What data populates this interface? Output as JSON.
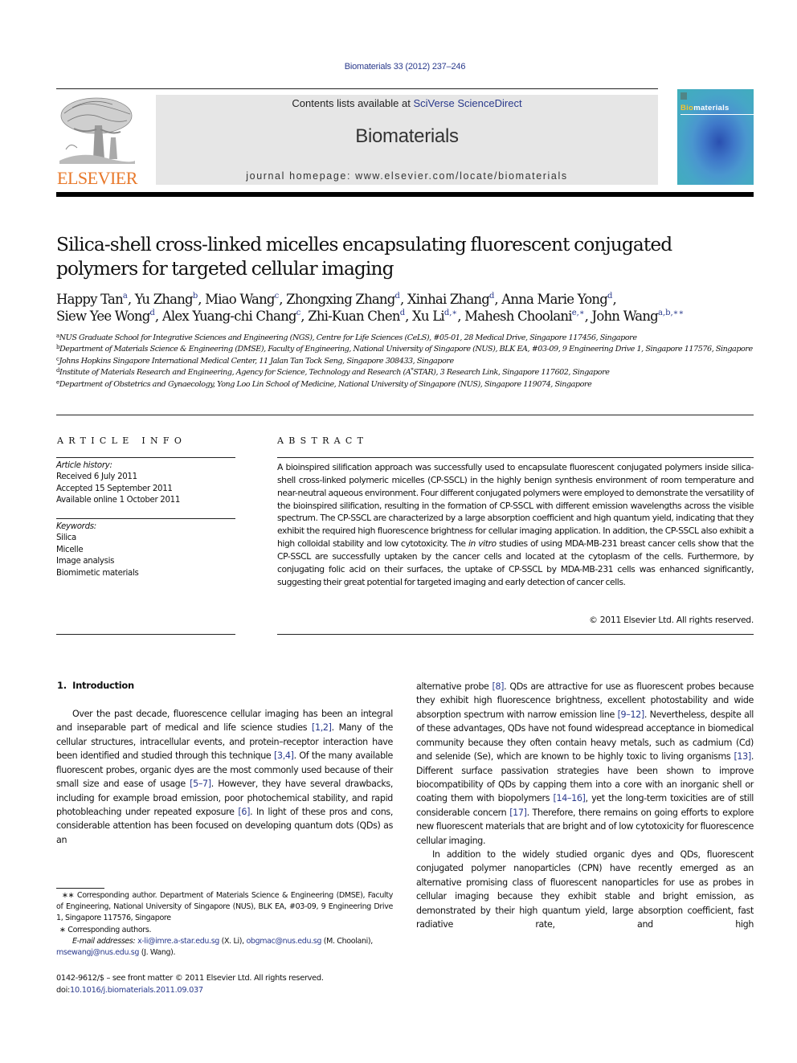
{
  "header": {
    "citation": "Biomaterials 33 (2012) 237–246",
    "publisher_logo_text": "ELSEVIER",
    "contents_prefix": "Contents lists available at ",
    "contents_link": "SciVerse ScienceDirect",
    "journal_title": "Biomaterials",
    "homepage_line": "journal homepage: www.elsevier.com/locate/biomaterials",
    "cover": {
      "title_highlight": "Bio",
      "title_rest": "materials",
      "colors": {
        "highlight": "#f3c42e",
        "background": "#46a6c7"
      }
    }
  },
  "article": {
    "title": "Silica-shell cross-linked micelles encapsulating fluorescent conjugated polymers for targeted cellular imaging",
    "authors": [
      {
        "name": "Happy Tan",
        "sup": "a",
        "sep": ", "
      },
      {
        "name": "Yu Zhang",
        "sup": "b",
        "sep": ", "
      },
      {
        "name": "Miao Wang",
        "sup": "c",
        "sep": ", "
      },
      {
        "name": "Zhongxing Zhang",
        "sup": "d",
        "sep": ", "
      },
      {
        "name": "Xinhai Zhang",
        "sup": "d",
        "sep": ", "
      },
      {
        "name": "Anna Marie Yong",
        "sup": "d",
        "sep": ", "
      },
      {
        "name": "Siew Yee Wong",
        "sup": "d",
        "sep": ", "
      },
      {
        "name": "Alex Yuang-chi Chang",
        "sup": "c",
        "sep": ", "
      },
      {
        "name": "Zhi-Kuan Chen",
        "sup": "d",
        "sep": ", "
      },
      {
        "name": "Xu Li",
        "sup": "d,∗",
        "sep": ", "
      },
      {
        "name": "Mahesh Choolani",
        "sup": "e,∗",
        "sep": ", "
      },
      {
        "name": "John Wang",
        "sup": "a,b,∗∗",
        "sep": ""
      }
    ],
    "affiliations": [
      {
        "key": "a",
        "text": "NUS Graduate School for Integrative Sciences and Engineering (NGS), Centre for Life Sciences (CeLS), #05-01, 28 Medical Drive, Singapore 117456, Singapore"
      },
      {
        "key": "b",
        "text": "Department of Materials Science & Engineering (DMSE), Faculty of Engineering, National University of Singapore (NUS), BLK EA, #03-09, 9 Engineering Drive 1, Singapore 117576, Singapore"
      },
      {
        "key": "c",
        "text": "Johns Hopkins Singapore International Medical Center, 11 Jalan Tan Tock Seng, Singapore 308433, Singapore"
      },
      {
        "key": "d",
        "text_before": "Institute of Materials Research and Engineering, Agency for Science, Technology and Research (A",
        "text_sup": "*",
        "text_after": "STAR), 3 Research Link, Singapore 117602, Singapore"
      },
      {
        "key": "e",
        "text": "Department of Obstetrics and Gynaecology, Yong Loo Lin School of Medicine, National University of Singapore (NUS), Singapore 119074, Singapore"
      }
    ]
  },
  "article_info": {
    "heading": "ARTICLE INFO",
    "history_label": "Article history:",
    "history": [
      "Received 6 July 2011",
      "Accepted 15 September 2011",
      "Available online 1 October 2011"
    ],
    "keywords_label": "Keywords:",
    "keywords": [
      "Silica",
      "Micelle",
      "Image analysis",
      "Biomimetic materials"
    ]
  },
  "abstract": {
    "heading": "ABSTRACT",
    "text_before_italic": "A bioinspired silification approach was successfully used to encapsulate fluorescent conjugated polymers inside silica-shell cross-linked polymeric micelles (CP-SSCL) in the highly benign synthesis environment of room temperature and near-neutral aqueous environment. Four different conjugated polymers were employed to demonstrate the versatility of the bioinspired silification, resulting in the formation of CP-SSCL with different emission wavelengths across the visible spectrum. The CP-SSCL are characterized by a large absorption coefficient and high quantum yield, indicating that they exhibit the required high fluorescence brightness for cellular imaging application. In addition, the CP-SSCL also exhibit a high colloidal stability and low cytotoxicity. The ",
    "italic": "in vitro",
    "text_after_italic": " studies of using MDA-MB-231 breast cancer cells show that the CP-SSCL are successfully uptaken by the cancer cells and located at the cytoplasm of the cells. Furthermore, by conjugating folic acid on their surfaces, the uptake of CP-SSCL by MDA-MB-231 cells was enhanced significantly, suggesting their great potential for targeted imaging and early detec­tion of cancer cells.",
    "copyright": "© 2011 Elsevier Ltd. All rights reserved."
  },
  "introduction": {
    "heading": "1.  Introduction",
    "left_paragraph": [
      {
        "t": "Over the past decade, fluorescence cellular imaging has been an integral and inseparable part of medical and life science studies "
      },
      {
        "ref": "[1,2]"
      },
      {
        "t": ". Many of the cellular structures, intracellular events, and protein–receptor interaction have been identified and studied through this technique "
      },
      {
        "ref": "[3,4]"
      },
      {
        "t": ". Of the many available fluorescent probes, organic dyes are the most commonly used because of their small size and ease of usage "
      },
      {
        "ref": "[5–7]"
      },
      {
        "t": ". However, they have several drawbacks, including for example broad emission, poor photo­chemical stability, and rapid photobleaching under repeated exposure "
      },
      {
        "ref": "[6]"
      },
      {
        "t": ". In light of these pros and cons, considerable attention has been focused on developing quantum dots (QDs) as an"
      }
    ],
    "right_paragraph_1": [
      {
        "t": "alternative probe "
      },
      {
        "ref": "[8]"
      },
      {
        "t": ". QDs are attractive for use as fluorescent probes because they exhibit high fluorescence brightness, excellent photostability and wide absorption spectrum with narrow emis­sion line "
      },
      {
        "ref": "[9–12]"
      },
      {
        "t": ". Nevertheless, despite all of these advantages, QDs have not found widespread acceptance in biomedical community because they often contain heavy metals, such as cadmium (Cd) and selenide (Se), which are known to be highly toxic to living organisms "
      },
      {
        "ref": "[13]"
      },
      {
        "t": ". Different surface passivation strategies have been shown to improve biocompatibility of QDs by capping them into a core with an inorganic shell or coating them with biopolymers "
      },
      {
        "ref": "[14–16]"
      },
      {
        "t": ", yet the long-term toxicities are of still considerable concern "
      },
      {
        "ref": "[17]"
      },
      {
        "t": ". Therefore, there remains on going efforts to explore new fluorescent materials that are bright and of low cytotoxicity for fluorescence cellular imaging."
      }
    ],
    "right_paragraph_2": "In addition to the widely studied organic dyes and QDs, fluo­rescent conjugated polymer nanoparticles (CPN) have recently emerged as an alternative promising class of fluorescent nano­particles for use as probes in cellular imaging because they exhibit stable and bright emission, as demonstrated by their high quantum yield, large absorption coefficient, fast radiative rate, and high"
  },
  "footnotes": {
    "double_star": "∗∗ Corresponding author. Department of Materials Science & Engineering (DMSE), Faculty of Engineering, National University of Singapore (NUS), BLK EA, #03-09, 9 Engineering Drive 1, Singapore 117576, Singapore",
    "single_star": "∗ Corresponding authors.",
    "email_label": "E-mail addresses:",
    "emails": [
      {
        "address": "x-li@imre.a-star.edu.sg",
        "name": " (X. Li), "
      },
      {
        "address": "obgmac@nus.edu.sg",
        "name": " (M. Choolani), "
      },
      {
        "address": "msewangj@nus.edu.sg",
        "name": " (J. Wang)."
      }
    ],
    "issn_line": "0142-9612/$ – see front matter © 2011 Elsevier Ltd. All rights reserved.",
    "doi_label": "doi:",
    "doi": "10.1016/j.biomaterials.2011.09.037"
  },
  "colors": {
    "link": "#2a3a8c",
    "elsevier_orange": "#e8782a",
    "banner_bg": "#e6e6e6"
  }
}
